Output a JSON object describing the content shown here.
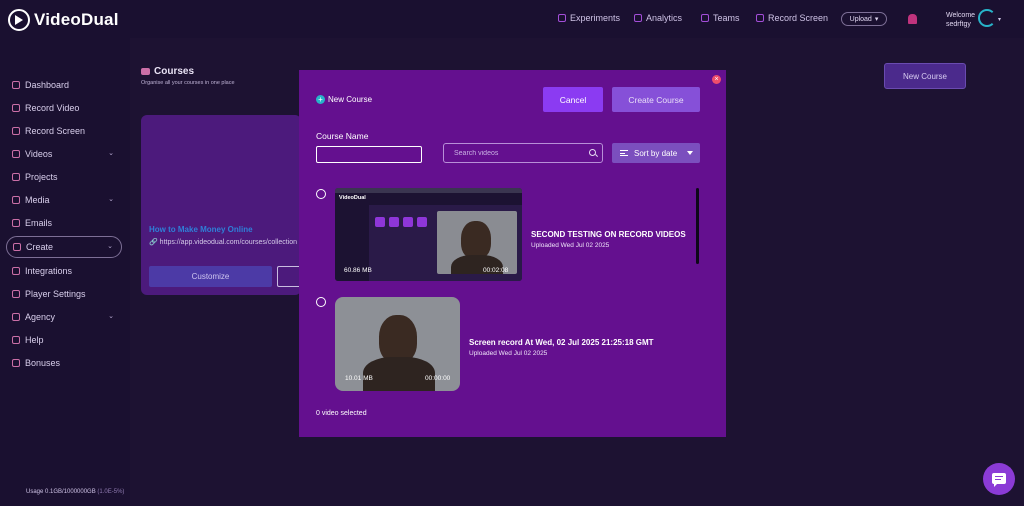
{
  "app": {
    "name": "VideoDual"
  },
  "topnav": {
    "experiments": "Experiments",
    "analytics": "Analytics",
    "teams": "Teams",
    "record_screen": "Record Screen",
    "upload": "Upload",
    "welcome": "Welcome",
    "username": "sedrftgy"
  },
  "sidebar": {
    "items": [
      {
        "label": "Dashboard"
      },
      {
        "label": "Record Video"
      },
      {
        "label": "Record Screen"
      },
      {
        "label": "Videos"
      },
      {
        "label": "Projects"
      },
      {
        "label": "Media"
      },
      {
        "label": "Emails"
      },
      {
        "label": "Create"
      },
      {
        "label": "Integrations"
      },
      {
        "label": "Player Settings"
      },
      {
        "label": "Agency"
      },
      {
        "label": "Help"
      },
      {
        "label": "Bonuses"
      }
    ],
    "usage": "Usage 0.1GB/1000000GB",
    "usage_pct": "(1.0E-5%)"
  },
  "courses_page": {
    "title": "Courses",
    "subtitle": "Organise all your courses in one place",
    "new_course": "New Course",
    "card": {
      "title": "How to Make Money Online",
      "url": "https://app.videodual.com/courses/collection",
      "customize": "Customize"
    }
  },
  "modal": {
    "close": "×",
    "new_course": "New Course",
    "cancel": "Cancel",
    "create_course": "Create Course",
    "course_name_label": "Course Name",
    "course_name_value": "",
    "search_placeholder": "Search videos",
    "sort_label": "Sort by date",
    "videos": [
      {
        "title": "SECOND TESTING ON RECORD VIDEOS",
        "uploaded": "Uploaded Wed Jul 02 2025",
        "size": "60.86 MB",
        "duration": "00:02:08",
        "thumb_logo": "VideoDual"
      },
      {
        "title": "Screen record At Wed, 02 Jul 2025 21:25:18 GMT",
        "uploaded": "Uploaded Wed Jul 02 2025",
        "size": "10.01 MB",
        "duration": "00:00:00"
      }
    ],
    "selected_count": "0 video selected"
  },
  "colors": {
    "background": "#1d1232",
    "modal": "#64108f",
    "accent": "#8b3bf2",
    "link": "#2f7fd8"
  }
}
